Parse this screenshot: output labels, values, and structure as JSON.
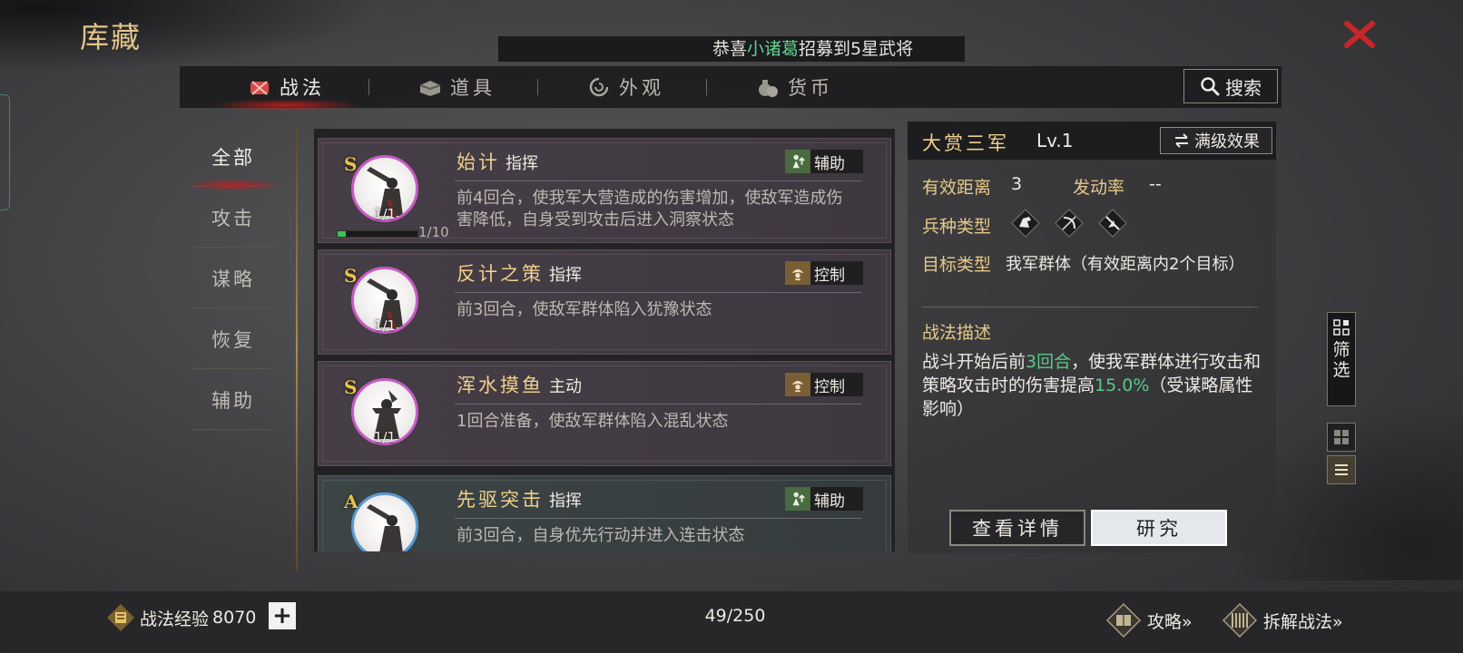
{
  "header": {
    "title": "库藏",
    "notice": {
      "prefix": "恭喜",
      "highlight": "小诸葛",
      "suffix": "招募到5星武将"
    }
  },
  "tabs": [
    {
      "label": "战法",
      "icon": "scroll-bundle-icon",
      "active": true
    },
    {
      "label": "道具",
      "icon": "chest-icon",
      "active": false
    },
    {
      "label": "外观",
      "icon": "swirl-icon",
      "active": false
    },
    {
      "label": "货币",
      "icon": "money-bag-icon",
      "active": false
    }
  ],
  "search": {
    "label": "搜索"
  },
  "categories": [
    {
      "label": "全部",
      "active": true
    },
    {
      "label": "攻击",
      "active": false
    },
    {
      "label": "谋略",
      "active": false
    },
    {
      "label": "恢复",
      "active": false
    },
    {
      "label": "辅助",
      "active": false
    }
  ],
  "cards": [
    {
      "grade": "S",
      "name": "始计",
      "type": "指挥",
      "badge": "辅助",
      "badge_color": "green",
      "count": "1/1",
      "progress_text": "1/10",
      "progress_fraction": 0.1,
      "desc": "前4回合，使我军大营造成的伤害增加，使敌军造成伤害降低，自身受到攻击后进入洞察状态"
    },
    {
      "grade": "S",
      "name": "反计之策",
      "type": "指挥",
      "badge": "控制",
      "badge_color": "orange",
      "count": "1/1",
      "desc": "前3回合，使敌军群体陷入犹豫状态"
    },
    {
      "grade": "S",
      "name": "浑水摸鱼",
      "type": "主动",
      "badge": "控制",
      "badge_color": "orange",
      "count": "1/1",
      "desc": "1回合准备，使敌军群体陷入混乱状态"
    },
    {
      "grade": "A",
      "name": "先驱突击",
      "type": "指挥",
      "badge": "辅助",
      "badge_color": "green",
      "desc": "前3回合，自身优先行动并进入连击状态"
    }
  ],
  "detail": {
    "name": "大赏三军",
    "level": "Lv.1",
    "max_effect_label": "满级效果",
    "range_label": "有效距离",
    "range_value": "3",
    "rate_label": "发动率",
    "rate_value": "--",
    "troop_label": "兵种类型",
    "troop_icons": [
      "cavalry-icon",
      "archer-icon",
      "spear-icon"
    ],
    "target_label": "目标类型",
    "target_value": "我军群体（有效距离内2个目标）",
    "desc_title": "战法描述",
    "desc": {
      "p1": "战斗开始后前",
      "h1": "3回合",
      "p2": "，使我军群体进行攻击和策略攻击时的伤害提高",
      "h2": "15.0%",
      "p3": "（受谋略属性影响）"
    },
    "detail_button": "查看详情",
    "research_button": "研究"
  },
  "side": {
    "filter_label_1": "筛",
    "filter_label_2": "选"
  },
  "footer": {
    "exp_label": "战法经验",
    "exp_value": "8070",
    "plus": "+",
    "page_count": "49/250",
    "guide_label": "攻略»",
    "disassemble_label": "拆解战法»"
  },
  "colors": {
    "accent_gold": "#f0cf8c",
    "highlight_green": "#58c987",
    "tab_red": "#be1e1e",
    "close_red": "#c8262a"
  }
}
